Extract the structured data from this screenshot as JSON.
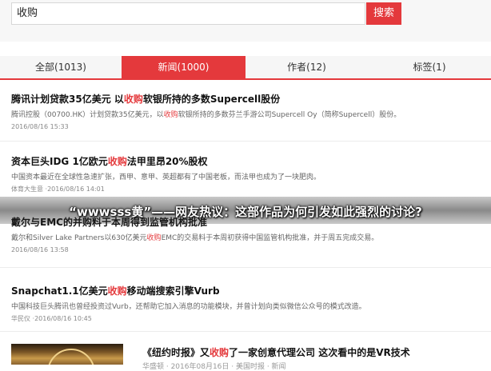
{
  "search": {
    "query": "收购",
    "button_label": "搜索"
  },
  "tabs": [
    {
      "label": "全部(1013)",
      "active": false
    },
    {
      "label": "新闻(1000)",
      "active": true
    },
    {
      "label": "作者(12)",
      "active": false
    },
    {
      "label": "标签(1)",
      "active": false
    }
  ],
  "colors": {
    "accent": "#e4393c"
  },
  "results": [
    {
      "title_pre": "腾讯计划贷款35亿美元 以",
      "title_hl": "收购",
      "title_post": "软银所持的多数Supercell股份",
      "snippet_pre": "腾讯控股（00700.HK）计划贷款35亿美元，以",
      "snippet_hl": "收购",
      "snippet_post": "软银所持的多数芬兰手游公司Supercell Oy（简称Supercell）股份。",
      "meta": "2016/08/16 15:33"
    },
    {
      "title_pre": "资本巨头IDG 1亿欧元",
      "title_hl": "收购",
      "title_post": "法甲里昂20%股权",
      "snippet_pre": "中国资本最近在全球性急速扩张，西甲、意甲、英超都有了中国老板，而法甲也成为了一块肥肉。",
      "snippet_hl": "",
      "snippet_post": "",
      "meta": "体育大生意 ·2016/08/16 14:01"
    },
    {
      "title_pre": "戴尔与EMC的并购料于本周得到监管机构批准",
      "title_hl": "",
      "title_post": "",
      "snippet_pre": "戴尔和Silver Lake Partners以630亿美元",
      "snippet_hl": "收购",
      "snippet_post": "EMC的交易料于本周初获得中国监管机构批准，并于周五完成交易。",
      "meta": "2016/08/16 13:58"
    },
    {
      "title_pre": "Snapchat1.1亿美元",
      "title_hl": "收购",
      "title_post": "移动端搜索引擎Vurb",
      "snippet_pre": "中国科技巨头腾讯也曾经投资过Vurb，还帮助它加入消息的功能模块，并曾计划向类似微信公众号的模式改造。",
      "snippet_hl": "",
      "snippet_post": "",
      "meta": "华民仪 ·2016/08/16 10:45"
    }
  ],
  "last_result": {
    "title_pre": "《纽约时报》又",
    "title_hl": "收购",
    "title_post": "了一家创意代理公司 这次看中的是VR技术",
    "snippet": "华盛顿 · 2016年08月16日 · 美国时报 · 新闻"
  },
  "overlay_text": "“wwwsss黄”——网友热议：这部作品为何引发如此强烈的讨论?"
}
